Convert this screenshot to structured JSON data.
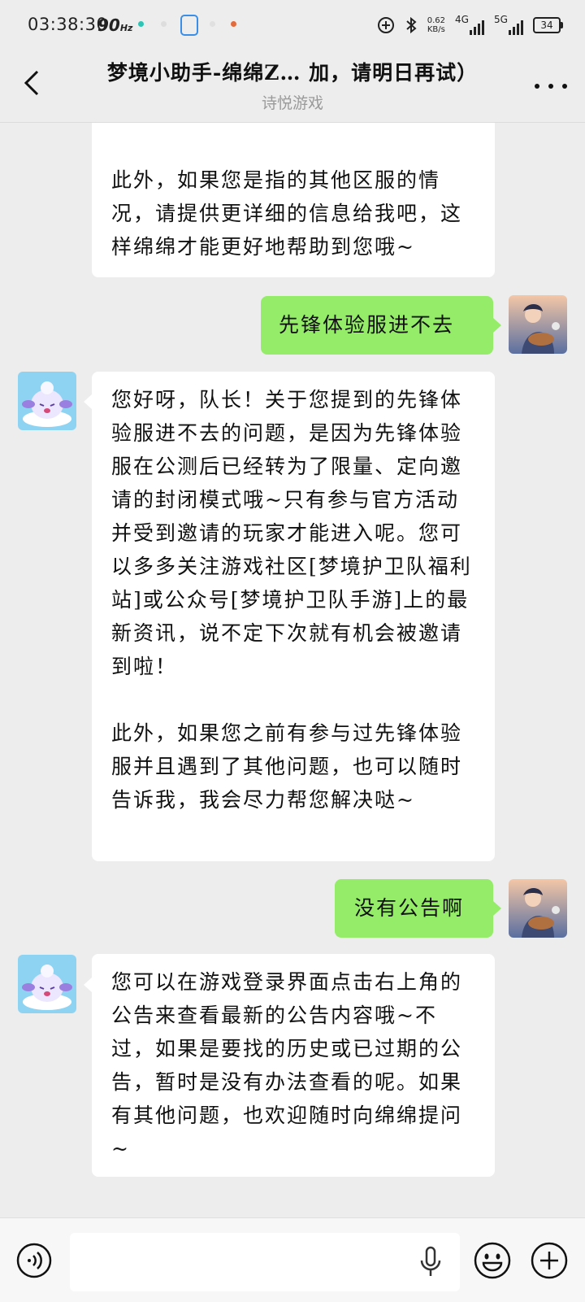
{
  "status_bar": {
    "time": "03:38:30",
    "refresh_rate": "90",
    "refresh_unit": "Hz",
    "net_speed_value": "0.62",
    "net_speed_unit": "KB/s",
    "network_1": "4G",
    "network_2": "5G",
    "battery": "34"
  },
  "header": {
    "title": "梦境小助手-绵绵Z… 加，请明日再试）",
    "subtitle": "诗悦游戏"
  },
  "messages": [
    {
      "side": "in",
      "text": "请关注游戏公告\n\n此外，如果您是指的其他区服的情况，请提供更详细的信息给我吧，这样绵绵才能更好地帮助到您哦~"
    },
    {
      "side": "out",
      "text": "先锋体验服进不去"
    },
    {
      "side": "in",
      "text": "您好呀，队长！关于您提到的先锋体验服进不去的问题，是因为先锋体验服在公测后已经转为了限量、定向邀请的封闭模式哦~只有参与官方活动并受到邀请的玩家才能进入呢。您可以多多关注游戏社区[梦境护卫队福利站]或公众号[梦境护卫队手游]上的最新资讯，说不定下次就有机会被邀请到啦！\n\n此外，如果您之前有参与过先锋体验服并且遇到了其他问题，也可以随时告诉我，我会尽力帮您解决哒~"
    },
    {
      "side": "out",
      "text": "没有公告啊"
    },
    {
      "side": "in",
      "text": "您可以在游戏登录界面点击右上角的公告来查看最新的公告内容哦~不过，如果是要找的历史或已过期的公告，暂时是没有办法查看的呢。如果有其他问题，也欢迎随时向绵绵提问~"
    }
  ],
  "input": {
    "placeholder": ""
  },
  "icons": {
    "back": "back-arrow-icon",
    "more": "more-dots-icon",
    "voice": "voice-input-icon",
    "mic": "microphone-icon",
    "emoji": "emoji-icon",
    "plus": "plus-icon"
  },
  "colors": {
    "outgoing_bubble": "#95ec69",
    "incoming_bubble": "#ffffff",
    "background": "#ededed"
  }
}
